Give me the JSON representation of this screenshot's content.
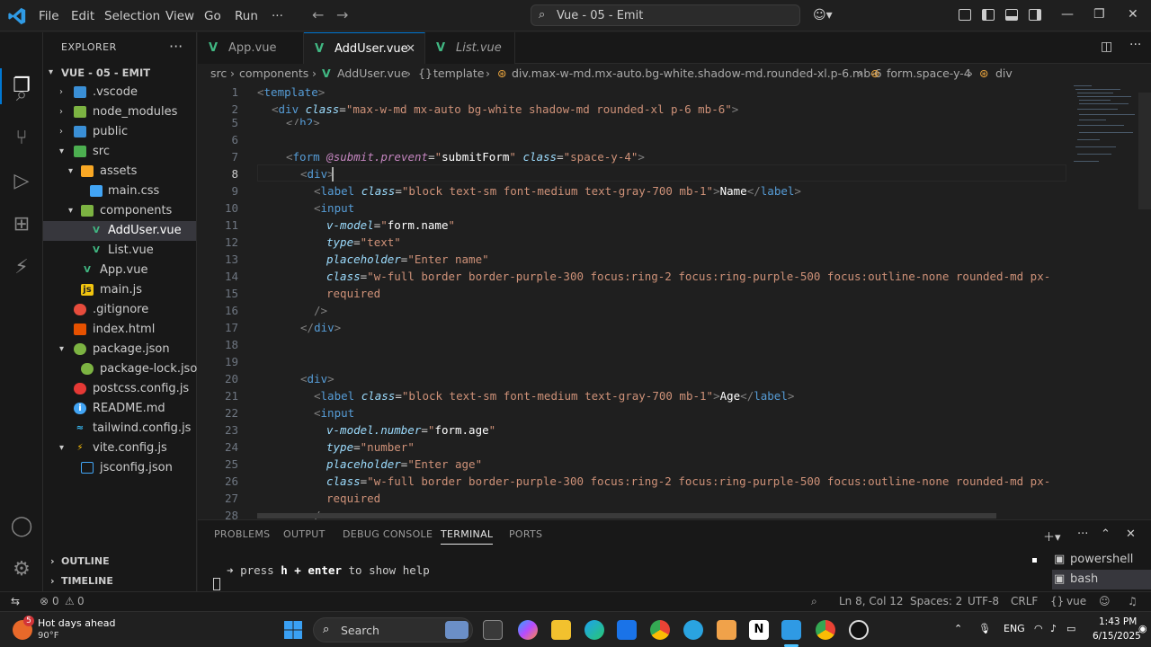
{
  "titlebar": {
    "menu": [
      "File",
      "Edit",
      "Selection",
      "View",
      "Go",
      "Run",
      "···"
    ],
    "command_center": "Vue - 05 - Emit"
  },
  "sidebar": {
    "header": "EXPLORER",
    "root": "VUE - 05 - EMIT",
    "items": [
      {
        "label": ".vscode",
        "icon": "vscode-folder-icon",
        "color": "#3a8fd6"
      },
      {
        "label": "node_modules",
        "icon": "node-folder-icon",
        "color": "#7cb342"
      },
      {
        "label": "public",
        "icon": "public-folder-icon",
        "color": "#3a8fd6"
      },
      {
        "label": "src",
        "icon": "src-folder-icon",
        "color": "#4caf50"
      },
      {
        "label": "assets",
        "icon": "assets-folder-icon",
        "color": "#f9a825"
      },
      {
        "label": "main.css",
        "icon": "css-file-icon",
        "color": "#42a5f5"
      },
      {
        "label": "components",
        "icon": "components-folder-icon",
        "color": "#7cb342"
      },
      {
        "label": "AddUser.vue",
        "icon": "vue-file-icon",
        "color": "#41b883"
      },
      {
        "label": "List.vue",
        "icon": "vue-file-icon",
        "color": "#41b883"
      },
      {
        "label": "App.vue",
        "icon": "vue-file-icon",
        "color": "#41b883"
      },
      {
        "label": "main.js",
        "icon": "js-file-icon",
        "color": "#f1c40f"
      },
      {
        "label": ".gitignore",
        "icon": "git-file-icon",
        "color": "#e74c3c"
      },
      {
        "label": "index.html",
        "icon": "html-file-icon",
        "color": "#e65100"
      },
      {
        "label": "package.json",
        "icon": "npm-file-icon",
        "color": "#7cb342"
      },
      {
        "label": "package-lock.json",
        "icon": "npm-lock-file-icon",
        "color": "#7cb342"
      },
      {
        "label": "postcss.config.js",
        "icon": "postcss-file-icon",
        "color": "#e53935"
      },
      {
        "label": "README.md",
        "icon": "info-file-icon",
        "color": "#42a5f5"
      },
      {
        "label": "tailwind.config.js",
        "icon": "tailwind-file-icon",
        "color": "#38bdf8"
      },
      {
        "label": "vite.config.js",
        "icon": "vite-file-icon",
        "color": "#ffc107"
      },
      {
        "label": "jsconfig.json",
        "icon": "jsconfig-file-icon",
        "color": "#42a5f5"
      }
    ],
    "outline": "OUTLINE",
    "timeline": "TIMELINE"
  },
  "tabs": [
    {
      "label": "App.vue"
    },
    {
      "label": "AddUser.vue"
    },
    {
      "label": "List.vue"
    }
  ],
  "breadcrumb": [
    "src",
    "components",
    "AddUser.vue",
    "template",
    "div.max-w-md.mx-auto.bg-white.shadow-md.rounded-xl.p-6.mb-6",
    "form.space-y-4",
    "div"
  ],
  "editor": {
    "current_line": 8,
    "line_numbers": [
      "1",
      "2",
      "5",
      "6",
      "7",
      "8",
      "9",
      "10",
      "11",
      "12",
      "13",
      "14",
      "15",
      "16",
      "17",
      "18",
      "19",
      "20",
      "21",
      "22",
      "23",
      "24",
      "25",
      "26",
      "27",
      "28"
    ]
  },
  "panel": {
    "tabs": [
      "PROBLEMS",
      "OUTPUT",
      "DEBUG CONSOLE",
      "TERMINAL",
      "PORTS"
    ],
    "terminal_prompt": "➜",
    "terminal_before": "press",
    "terminal_key": "h + enter",
    "terminal_after": "to show help",
    "shells": [
      "powershell",
      "bash"
    ]
  },
  "statusbar": {
    "errors": "0",
    "warnings": "0",
    "position": "Ln 8, Col 12",
    "spaces": "Spaces: 2",
    "encoding": "UTF-8",
    "eol": "CRLF",
    "language": "vue"
  },
  "taskbar": {
    "weather_title": "Hot days ahead",
    "weather_temp": "90°F",
    "badge": "5",
    "search": "Search",
    "lang": "ENG",
    "time": "1:43 PM",
    "date": "6/15/2025"
  },
  "colors": {
    "accent": "#0078d4",
    "vue": "#41b883"
  }
}
